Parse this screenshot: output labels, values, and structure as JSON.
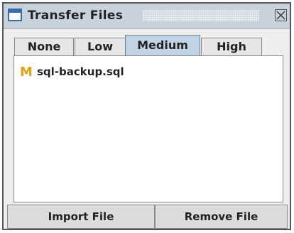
{
  "window": {
    "title": "Transfer Files"
  },
  "tabs": [
    {
      "label": "None",
      "selected": false
    },
    {
      "label": "Low",
      "selected": false
    },
    {
      "label": "Medium",
      "selected": true
    },
    {
      "label": "High",
      "selected": false
    }
  ],
  "files": [
    {
      "badge": "M",
      "name": "sql-backup.sql"
    }
  ],
  "buttons": {
    "import_label": "Import File",
    "remove_label": "Remove File"
  },
  "colors": {
    "titlebar": "#c8d2dd",
    "active_tab": "#c3d3e6",
    "badge": "#e2a212"
  },
  "icons": {
    "window": "window-icon",
    "close": "close-icon"
  }
}
